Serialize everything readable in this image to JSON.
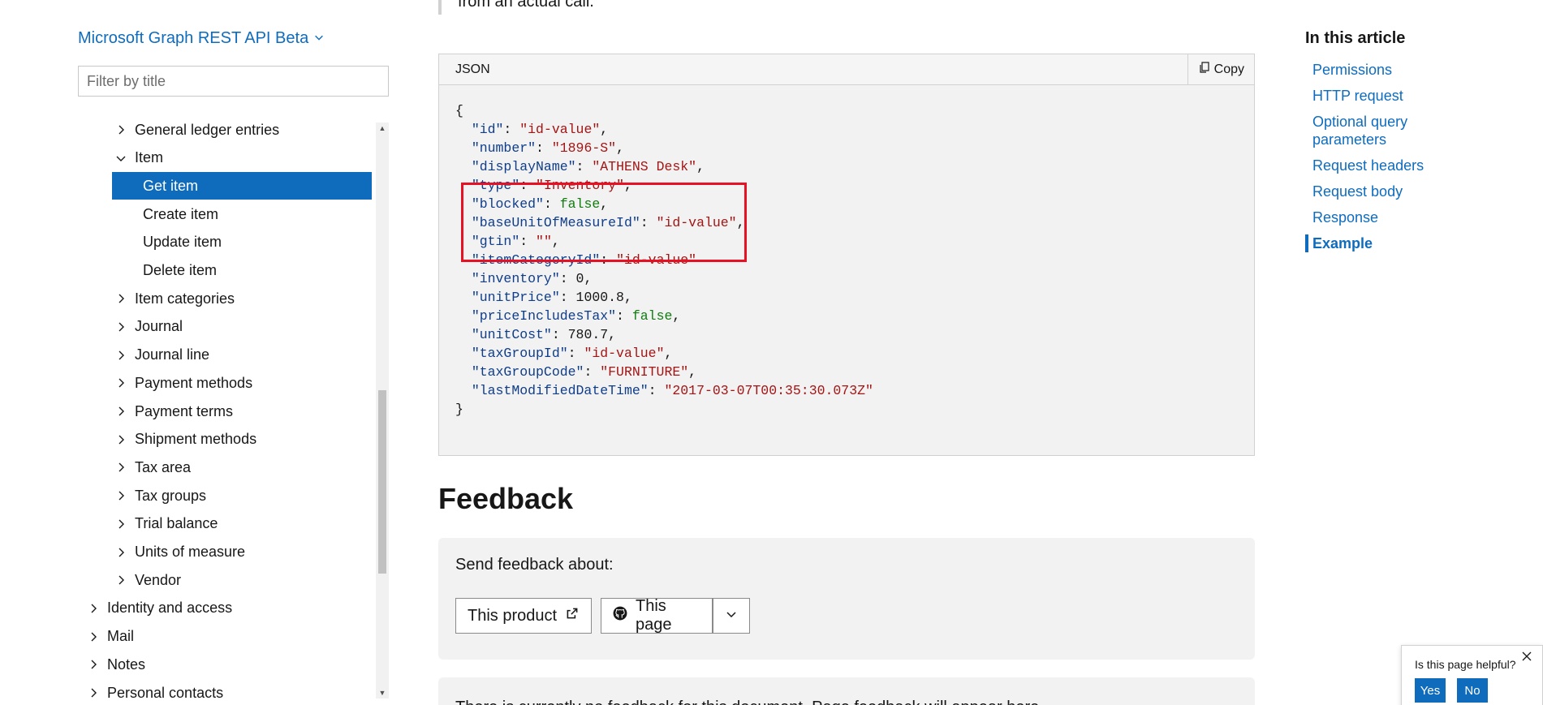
{
  "nav": {
    "product_title": "Microsoft Graph REST API Beta",
    "filter_placeholder": "Filter by title",
    "items": [
      {
        "label": "General ledger entries",
        "level": 1,
        "chevron": "right",
        "active": false
      },
      {
        "label": "Item",
        "level": 1,
        "chevron": "down",
        "active": false
      },
      {
        "label": "Get item",
        "level": 2,
        "chevron": "",
        "active": true
      },
      {
        "label": "Create item",
        "level": 2,
        "chevron": "",
        "active": false
      },
      {
        "label": "Update item",
        "level": 2,
        "chevron": "",
        "active": false
      },
      {
        "label": "Delete item",
        "level": 2,
        "chevron": "",
        "active": false
      },
      {
        "label": "Item categories",
        "level": 1,
        "chevron": "right",
        "active": false
      },
      {
        "label": "Journal",
        "level": 1,
        "chevron": "right",
        "active": false
      },
      {
        "label": "Journal line",
        "level": 1,
        "chevron": "right",
        "active": false
      },
      {
        "label": "Payment methods",
        "level": 1,
        "chevron": "right",
        "active": false
      },
      {
        "label": "Payment terms",
        "level": 1,
        "chevron": "right",
        "active": false
      },
      {
        "label": "Shipment methods",
        "level": 1,
        "chevron": "right",
        "active": false
      },
      {
        "label": "Tax area",
        "level": 1,
        "chevron": "right",
        "active": false
      },
      {
        "label": "Tax groups",
        "level": 1,
        "chevron": "right",
        "active": false
      },
      {
        "label": "Trial balance",
        "level": 1,
        "chevron": "right",
        "active": false
      },
      {
        "label": "Units of measure",
        "level": 1,
        "chevron": "right",
        "active": false
      },
      {
        "label": "Vendor",
        "level": 1,
        "chevron": "right",
        "active": false
      },
      {
        "label": "Identity and access",
        "level": 0,
        "chevron": "right",
        "active": false
      },
      {
        "label": "Mail",
        "level": 0,
        "chevron": "right",
        "active": false
      },
      {
        "label": "Notes",
        "level": 0,
        "chevron": "right",
        "active": false
      },
      {
        "label": "Personal contacts",
        "level": 0,
        "chevron": "right",
        "active": false
      }
    ]
  },
  "main": {
    "intro_text": "from an actual call.",
    "code": {
      "language": "JSON",
      "copy_label": "Copy",
      "lines": [
        [
          {
            "t": "{",
            "c": "p"
          }
        ],
        [
          {
            "t": "  ",
            "c": "p"
          },
          {
            "t": "\"id\"",
            "c": "k"
          },
          {
            "t": ": ",
            "c": "p"
          },
          {
            "t": "\"id-value\"",
            "c": "s"
          },
          {
            "t": ",",
            "c": "p"
          }
        ],
        [
          {
            "t": "  ",
            "c": "p"
          },
          {
            "t": "\"number\"",
            "c": "k"
          },
          {
            "t": ": ",
            "c": "p"
          },
          {
            "t": "\"1896-S\"",
            "c": "s"
          },
          {
            "t": ",",
            "c": "p"
          }
        ],
        [
          {
            "t": "  ",
            "c": "p"
          },
          {
            "t": "\"displayName\"",
            "c": "k"
          },
          {
            "t": ": ",
            "c": "p"
          },
          {
            "t": "\"ATHENS Desk\"",
            "c": "s"
          },
          {
            "t": ",",
            "c": "p"
          }
        ],
        [
          {
            "t": "  ",
            "c": "p"
          },
          {
            "t": "\"type\"",
            "c": "k"
          },
          {
            "t": ": ",
            "c": "p"
          },
          {
            "t": "\"Inventory\"",
            "c": "s"
          },
          {
            "t": ",",
            "c": "p"
          }
        ],
        [
          {
            "t": "  ",
            "c": "p"
          },
          {
            "t": "\"blocked\"",
            "c": "k"
          },
          {
            "t": ": ",
            "c": "p"
          },
          {
            "t": "false",
            "c": "b"
          },
          {
            "t": ",",
            "c": "p"
          }
        ],
        [
          {
            "t": "  ",
            "c": "p"
          },
          {
            "t": "\"baseUnitOfMeasureId\"",
            "c": "k"
          },
          {
            "t": ": ",
            "c": "p"
          },
          {
            "t": "\"id-value\"",
            "c": "s"
          },
          {
            "t": ",",
            "c": "p"
          }
        ],
        [
          {
            "t": "  ",
            "c": "p"
          },
          {
            "t": "\"gtin\"",
            "c": "k"
          },
          {
            "t": ": ",
            "c": "p"
          },
          {
            "t": "\"\"",
            "c": "s"
          },
          {
            "t": ",",
            "c": "p"
          }
        ],
        [
          {
            "t": "  ",
            "c": "p"
          },
          {
            "t": "\"itemCategoryId\"",
            "c": "k"
          },
          {
            "t": ": ",
            "c": "p"
          },
          {
            "t": "\"id-value\"",
            "c": "s"
          }
        ],
        [
          {
            "t": "  ",
            "c": "p"
          },
          {
            "t": "\"inventory\"",
            "c": "k"
          },
          {
            "t": ": ",
            "c": "p"
          },
          {
            "t": "0",
            "c": "n"
          },
          {
            "t": ",",
            "c": "p"
          }
        ],
        [
          {
            "t": "  ",
            "c": "p"
          },
          {
            "t": "\"unitPrice\"",
            "c": "k"
          },
          {
            "t": ": ",
            "c": "p"
          },
          {
            "t": "1000.8",
            "c": "n"
          },
          {
            "t": ",",
            "c": "p"
          }
        ],
        [
          {
            "t": "  ",
            "c": "p"
          },
          {
            "t": "\"priceIncludesTax\"",
            "c": "k"
          },
          {
            "t": ": ",
            "c": "p"
          },
          {
            "t": "false",
            "c": "b"
          },
          {
            "t": ",",
            "c": "p"
          }
        ],
        [
          {
            "t": "  ",
            "c": "p"
          },
          {
            "t": "\"unitCost\"",
            "c": "k"
          },
          {
            "t": ": ",
            "c": "p"
          },
          {
            "t": "780.7",
            "c": "n"
          },
          {
            "t": ",",
            "c": "p"
          }
        ],
        [
          {
            "t": "  ",
            "c": "p"
          },
          {
            "t": "\"taxGroupId\"",
            "c": "k"
          },
          {
            "t": ": ",
            "c": "p"
          },
          {
            "t": "\"id-value\"",
            "c": "s"
          },
          {
            "t": ",",
            "c": "p"
          }
        ],
        [
          {
            "t": "  ",
            "c": "p"
          },
          {
            "t": "\"taxGroupCode\"",
            "c": "k"
          },
          {
            "t": ": ",
            "c": "p"
          },
          {
            "t": "\"FURNITURE\"",
            "c": "s"
          },
          {
            "t": ",",
            "c": "p"
          }
        ],
        [
          {
            "t": "  ",
            "c": "p"
          },
          {
            "t": "\"lastModifiedDateTime\"",
            "c": "k"
          },
          {
            "t": ": ",
            "c": "p"
          },
          {
            "t": "\"2017-03-07T00:35:30.073Z\"",
            "c": "s"
          }
        ],
        [
          {
            "t": "}",
            "c": "p"
          }
        ]
      ]
    },
    "feedback": {
      "title": "Feedback",
      "send_label": "Send feedback about:",
      "product_button": "This product",
      "page_button": "This page",
      "no_feedback_text": "There is currently no feedback for this document. Page feedback will appear here."
    }
  },
  "rail": {
    "title": "In this article",
    "links": [
      {
        "label": "Permissions",
        "current": false
      },
      {
        "label": "HTTP request",
        "current": false
      },
      {
        "label": "Optional query parameters",
        "current": false
      },
      {
        "label": "Request headers",
        "current": false
      },
      {
        "label": "Request body",
        "current": false
      },
      {
        "label": "Response",
        "current": false
      },
      {
        "label": "Example",
        "current": true
      }
    ]
  },
  "helpful": {
    "question": "Is this page helpful?",
    "yes_label": "Yes",
    "no_label": "No"
  },
  "colors": {
    "accent": "#0f6cbd",
    "highlight_border": "#e81123",
    "json_key": "#0f3d8a",
    "json_string": "#a31515",
    "json_bool": "#107c10"
  }
}
